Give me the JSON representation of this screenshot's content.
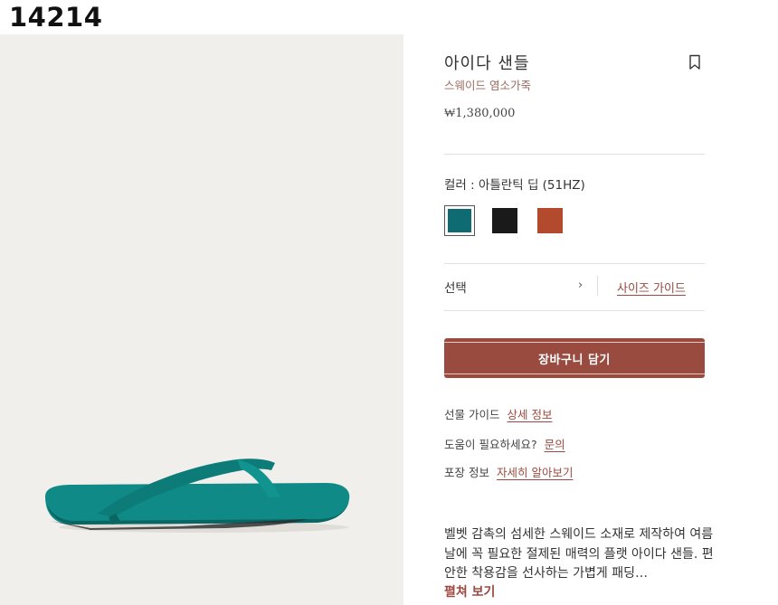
{
  "page_id": "14214",
  "product": {
    "title": "아이다 샌들",
    "subtitle": "스웨이드 염소가죽",
    "price": "₩1,380,000"
  },
  "color": {
    "label": "컬러 : 아틀란틱 딥 (51HZ)",
    "swatches": [
      {
        "name": "아틀란틱 딥",
        "hex": "#0f6b72",
        "selected": true
      },
      {
        "name": "black",
        "hex": "#1a1a1a",
        "selected": false
      },
      {
        "name": "brown",
        "hex": "#b34a2e",
        "selected": false
      }
    ]
  },
  "size": {
    "select_label": "선택",
    "guide_link": "사이즈 가이드"
  },
  "cart_button": "장바구니 담기",
  "info_rows": [
    {
      "label": "선물 가이드",
      "link": "상세 정보"
    },
    {
      "label": "도움이 필요하세요?",
      "link": "문의"
    },
    {
      "label": "포장 정보",
      "link": "자세히 알아보기"
    }
  ],
  "description": "벨벳 감촉의 섬세한 스웨이드 소재로 제작하여 여름날에 꼭 필요한 절제된 매력의 플랫 아이다 샌들. 편안한 착용감을 선사하는 가볍게 패딩…",
  "more_link": "펼쳐 보기",
  "colors": {
    "accent": "#9a4b40",
    "link": "#9c4a3f",
    "image_bg": "#f1efeb",
    "sandal": "#0f8a86"
  },
  "icons": {
    "bookmark": "bookmark-icon",
    "chevron": "chevron-right-icon"
  }
}
